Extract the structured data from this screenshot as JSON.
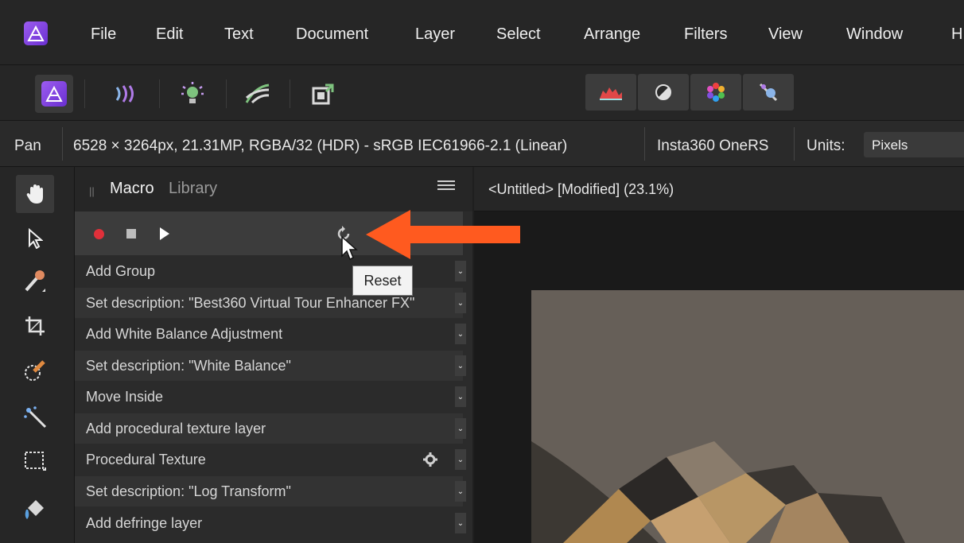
{
  "menubar": {
    "items": [
      "File",
      "Edit",
      "Text",
      "Document",
      "Layer",
      "Select",
      "Arrange",
      "Filters",
      "View",
      "Window",
      "H"
    ]
  },
  "toolbar": {
    "personas": [
      "photo-persona-icon",
      "liquify-persona-icon",
      "develop-persona-icon",
      "tone-mapping-persona-icon",
      "export-persona-icon"
    ],
    "modes": [
      "histogram-icon",
      "tone-map-icon",
      "color-wheel-icon",
      "hdr-merge-icon"
    ]
  },
  "context": {
    "tool": "Pan",
    "doc_info": "6528 × 3264px, 21.31MP, RGBA/32 (HDR) - sRGB IEC61966-2.1 (Linear)",
    "camera": "Insta360 OneRS",
    "units_label": "Units:",
    "units_value": "Pixels"
  },
  "panel": {
    "tab_macro": "Macro",
    "tab_library": "Library",
    "tooltip": "Reset",
    "rows": [
      {
        "label": "Add Group"
      },
      {
        "label": "Set description: \"Best360 Virtual Tour Enhancer FX\""
      },
      {
        "label": "Add White Balance Adjustment"
      },
      {
        "label": "Set description: \"White Balance\""
      },
      {
        "label": "Move Inside"
      },
      {
        "label": "Add procedural texture layer"
      },
      {
        "label": "Procedural Texture"
      },
      {
        "label": "Set description: \"Log Transform\""
      },
      {
        "label": "Add defringe layer"
      }
    ]
  },
  "document": {
    "title": "<Untitled> [Modified] (23.1%)"
  },
  "colors": {
    "accent": "#9c5cf0",
    "record": "#e0303a",
    "annotation_arrow": "#ff5a1f"
  }
}
